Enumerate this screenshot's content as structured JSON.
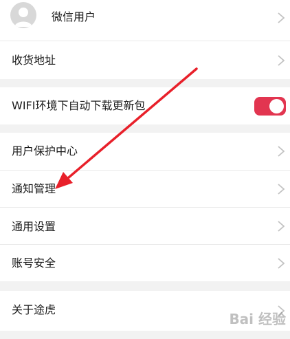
{
  "profile": {
    "username": "微信用户"
  },
  "address": {
    "label": "收货地址"
  },
  "wifi": {
    "label": "WIFI环境下自动下载更新包",
    "enabled": true
  },
  "menu": {
    "protection": "用户保护中心",
    "notifications": "通知管理",
    "general": "通用设置",
    "account": "账号安全"
  },
  "about": {
    "label": "关于途虎"
  },
  "watermark": {
    "text": "Bai 经验"
  },
  "colors": {
    "toggle_on": "#e23550",
    "annotation_arrow": "#e8202a",
    "chevron": "#c2c2c2",
    "background": "#f2f2f2"
  }
}
